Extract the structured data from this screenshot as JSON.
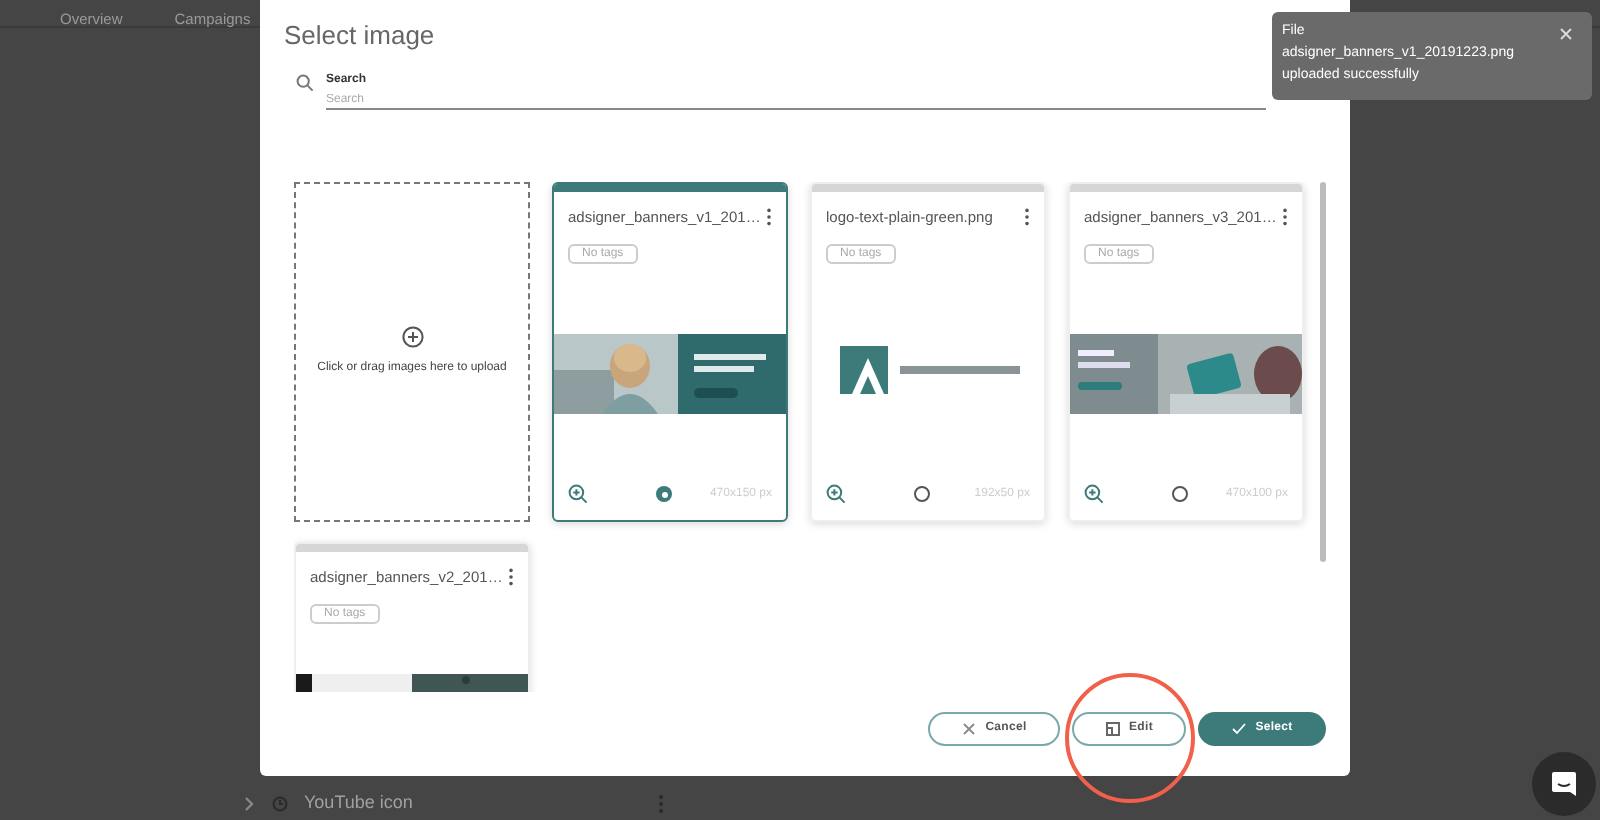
{
  "background": {
    "tabs": [
      {
        "label": "Overview",
        "selected": false
      },
      {
        "label": "Campaigns",
        "selected": false
      }
    ],
    "list_item": "YouTube icon"
  },
  "dialog": {
    "title": "Select image",
    "search": {
      "label": "Search",
      "placeholder": "Search"
    },
    "upload_tile": "Click or drag images here to upload",
    "images": [
      {
        "name": "adsigner_banners_v1_201…",
        "tag": "No tags",
        "size": "470x150 px",
        "selected": true,
        "kind": "people"
      },
      {
        "name": "logo-text-plain-green.png",
        "tag": "No tags",
        "size": "192x50 px",
        "selected": false,
        "kind": "logo"
      },
      {
        "name": "adsigner_banners_v3_201…",
        "tag": "No tags",
        "size": "470x100 px",
        "selected": false,
        "kind": "keyboard"
      },
      {
        "name": "adsigner_banners_v2_201…",
        "tag": "No tags",
        "selected": false,
        "kind": "dark"
      }
    ],
    "buttons": [
      {
        "label": "Cancel",
        "kind": "outline"
      },
      {
        "label": "Edit",
        "kind": "outline"
      },
      {
        "label": "Select",
        "kind": "primary"
      }
    ]
  },
  "toast": {
    "lines": [
      "File",
      "adsigner_banners_v1_20191223.png",
      "uploaded successfully"
    ]
  }
}
